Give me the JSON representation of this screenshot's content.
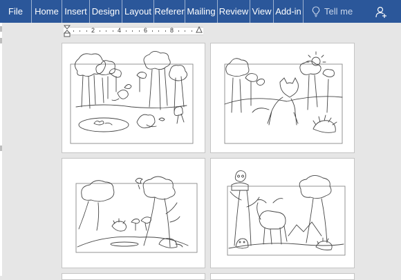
{
  "ribbon": {
    "tabs": [
      "File",
      "Home",
      "Insert",
      "Design",
      "Layout",
      "Referer",
      "Mailing",
      "Review",
      "View",
      "Add-in"
    ],
    "tell_me": "Tell me",
    "lightbulb_icon": "lightbulb-icon",
    "share_icon": "person-add-icon"
  },
  "ruler": {
    "numbers": [
      "2",
      "4",
      "6",
      "8"
    ]
  },
  "pages": [
    {
      "scene": "forest with skunks and frog pond"
    },
    {
      "scene": "fox and porcupine under sun"
    },
    {
      "scene": "forest with hedgehog and bird"
    },
    {
      "scene": "moose with owl and beaver"
    }
  ],
  "colors": {
    "ribbon": "#2b579a",
    "canvas": "#e6e6e6",
    "page": "#ffffff",
    "lineart": "#444444"
  }
}
